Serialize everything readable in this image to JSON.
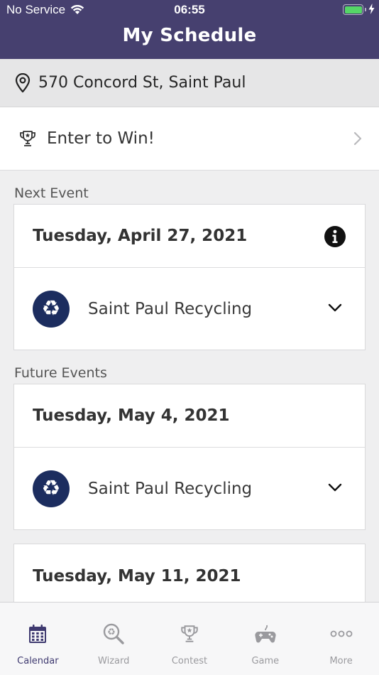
{
  "status_bar": {
    "carrier": "No Service",
    "time": "06:55"
  },
  "header": {
    "title": "My Schedule"
  },
  "address": {
    "text": "570 Concord St, Saint Paul",
    "icon": "location-pin-icon"
  },
  "contest_row": {
    "label": "Enter to Win!",
    "icon": "trophy-icon"
  },
  "next_event": {
    "section_label": "Next Event",
    "date": "Tuesday, April 27, 2021",
    "service": "Saint Paul Recycling"
  },
  "future_events": {
    "section_label": "Future Events",
    "events": [
      {
        "date": "Tuesday, May 4, 2021",
        "service": "Saint Paul Recycling"
      },
      {
        "date": "Tuesday, May 11, 2021"
      }
    ]
  },
  "tabbar": {
    "tabs": [
      {
        "label": "Calendar",
        "icon": "calendar-icon",
        "active": true
      },
      {
        "label": "Wizard",
        "icon": "recycle-search-icon",
        "active": false
      },
      {
        "label": "Contest",
        "icon": "trophy-icon",
        "active": false
      },
      {
        "label": "Game",
        "icon": "gamepad-icon",
        "active": false
      },
      {
        "label": "More",
        "icon": "more-dots-icon",
        "active": false
      }
    ]
  },
  "colors": {
    "header_bg": "#46406f",
    "badge_bg": "#1c2d5f",
    "active_tab": "#3f3a70",
    "inactive_tab": "#9a9a9e"
  }
}
